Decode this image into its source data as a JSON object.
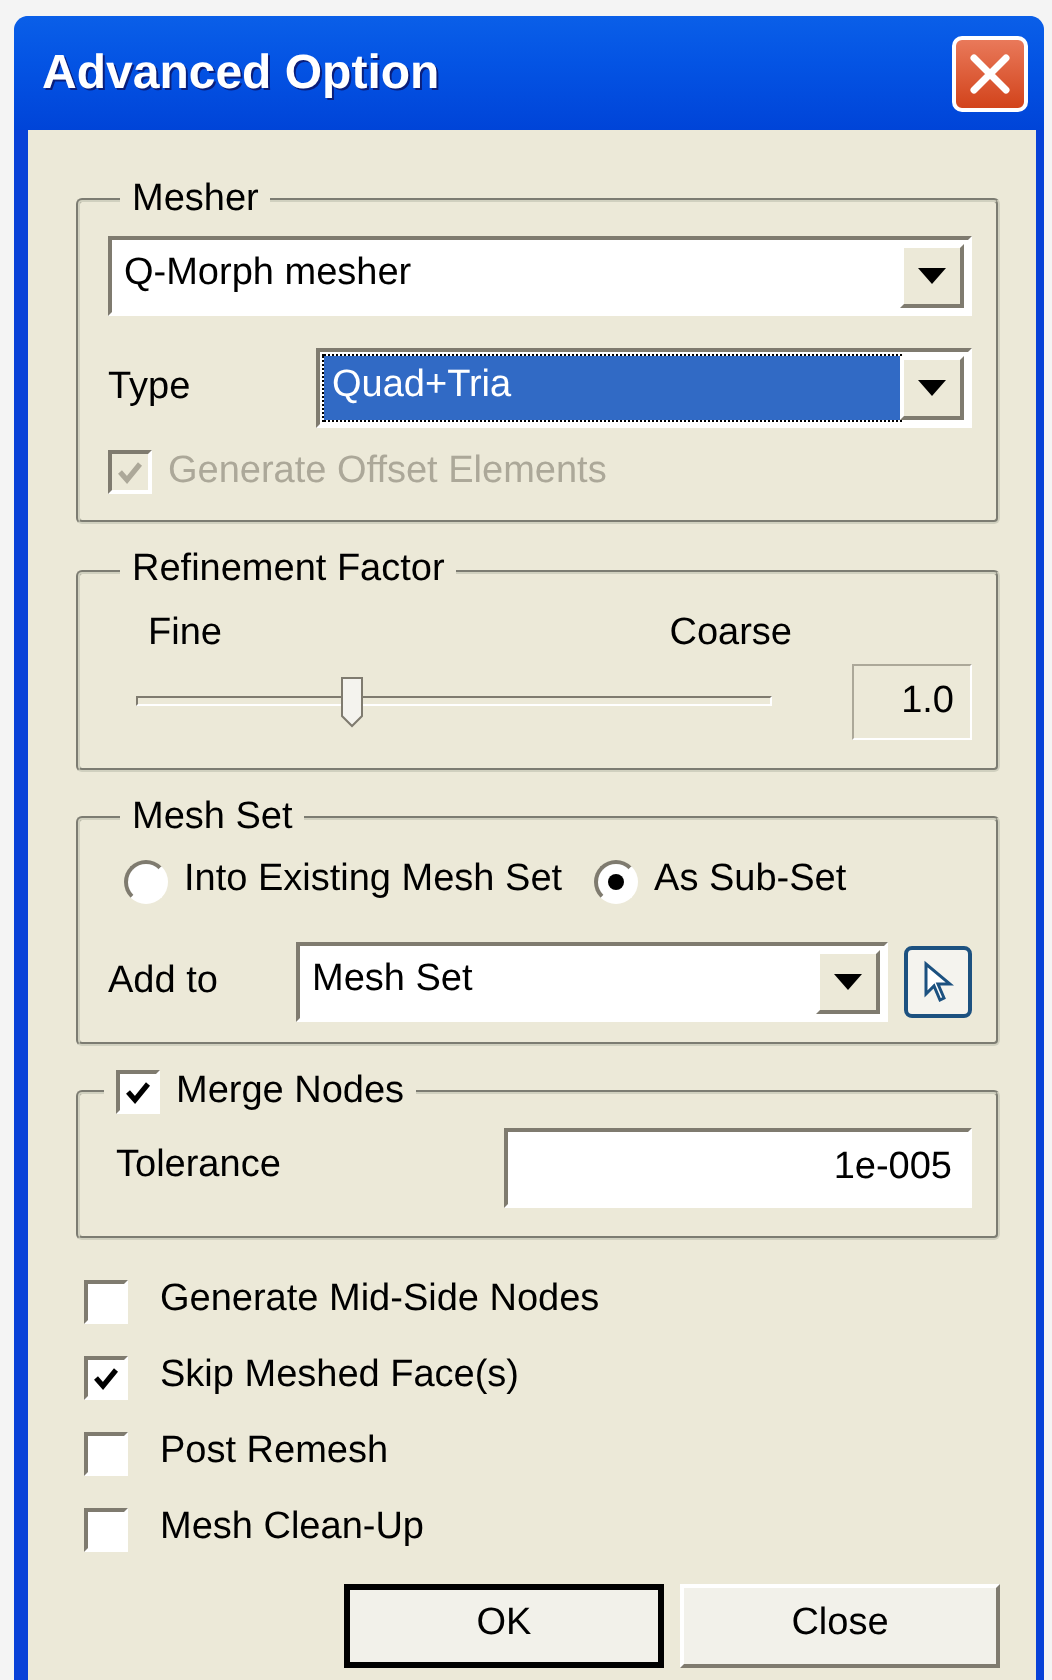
{
  "window": {
    "title": "Advanced Option"
  },
  "mesher": {
    "label": "Mesher",
    "method": "Q-Morph mesher",
    "type_label": "Type",
    "type_value": "Quad+Tria",
    "type_focused": true,
    "offset": {
      "label": "Generate Offset Elements",
      "checked": true,
      "disabled": true
    }
  },
  "refinement": {
    "label": "Refinement Factor",
    "min_label": "Fine",
    "max_label": "Coarse",
    "level": 0.34,
    "reading": "1.0"
  },
  "mesh_set": {
    "label": "Mesh Set",
    "options": [
      {
        "label": "Into Existing Mesh Set",
        "selected": false
      },
      {
        "label": "As Sub-Set",
        "selected": true
      }
    ],
    "add_to_label": "Add to",
    "add_to_value": "Mesh Set"
  },
  "merge_nodes": {
    "label": "Merge Nodes",
    "checked": true,
    "tolerance_label": "Tolerance",
    "tolerance": "1e-005"
  },
  "options": [
    {
      "label": "Generate Mid-Side Nodes",
      "checked": false
    },
    {
      "label": "Skip Meshed Face(s)",
      "checked": true
    },
    {
      "label": "Post Remesh",
      "checked": false
    },
    {
      "label": "Mesh Clean-Up",
      "checked": false
    }
  ],
  "buttons": [
    {
      "label": "OK",
      "default": true
    },
    {
      "label": "Close",
      "default": false
    }
  ]
}
